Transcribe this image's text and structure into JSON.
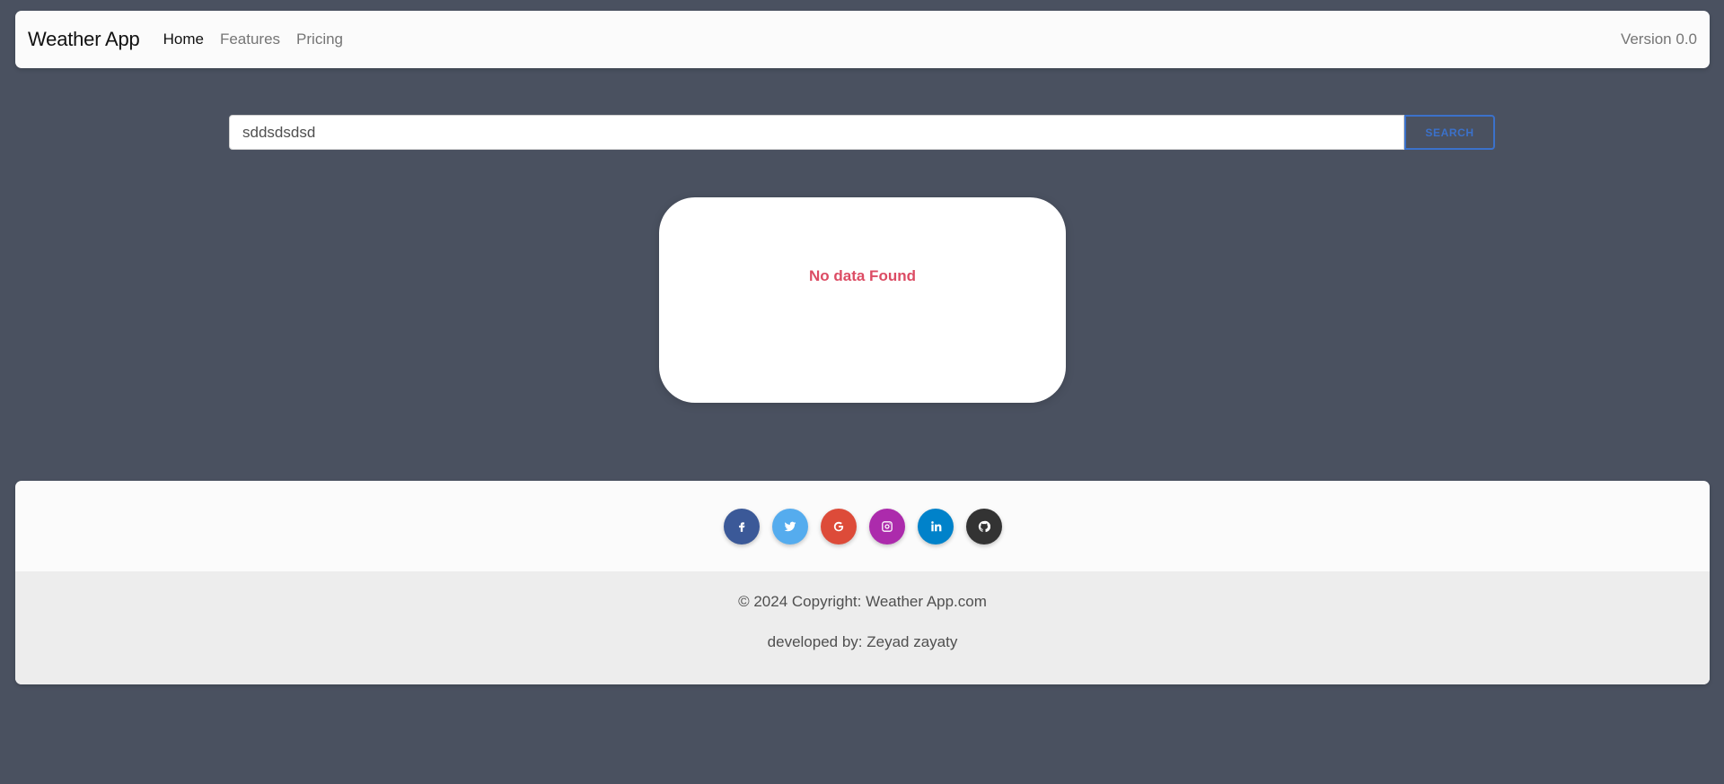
{
  "navbar": {
    "brand": "Weather App",
    "links": [
      {
        "label": "Home"
      },
      {
        "label": "Features"
      },
      {
        "label": "Pricing"
      }
    ],
    "version": "Version 0.0"
  },
  "search": {
    "value": "sddsdsdsd",
    "button_label": "SEARCH"
  },
  "result": {
    "message": "No data Found",
    "message_color": "#dc4c64"
  },
  "footer": {
    "social": [
      {
        "name": "facebook-icon",
        "color": "#3b5998"
      },
      {
        "name": "twitter-icon",
        "color": "#55acee"
      },
      {
        "name": "google-icon",
        "color": "#dd4b39"
      },
      {
        "name": "instagram-icon",
        "color": "#ac2bac"
      },
      {
        "name": "linkedin-icon",
        "color": "#0082ca"
      },
      {
        "name": "github-icon",
        "color": "#333333"
      }
    ],
    "copyright": "© 2024 Copyright: Weather App.com",
    "developer": "developed by: Zeyad zayaty"
  },
  "colors": {
    "background": "#4a5160",
    "accent": "#3b71ca"
  }
}
